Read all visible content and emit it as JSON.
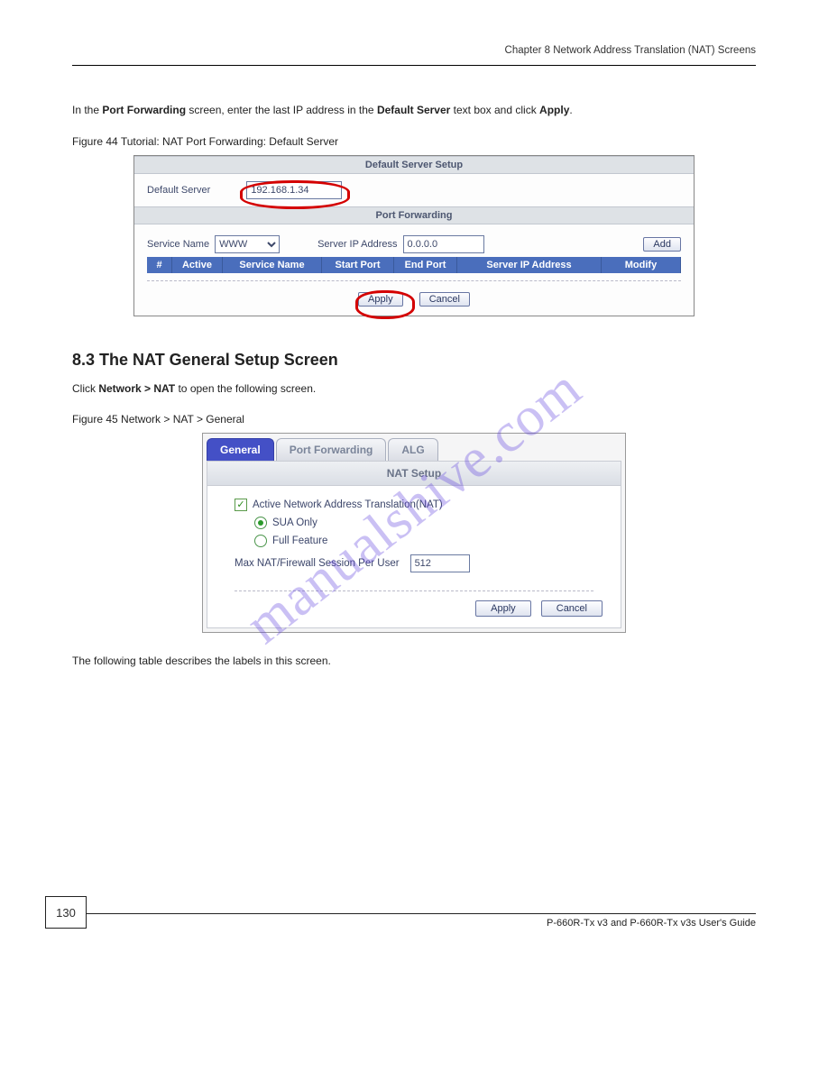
{
  "header": {
    "right_text": "Chapter 8 Network Address Translation (NAT) Screens"
  },
  "intro": {
    "p1_a": "In the ",
    "p1_b": "Port Forwarding",
    "p1_c": " screen, enter the last IP address in the ",
    "p1_d": "Default Server",
    "p1_e": " text box and click ",
    "p1_f": "Apply",
    "p1_g": "."
  },
  "fig1": {
    "caption": "Tutorial: NAT Port Forwarding: Default Server",
    "caption_no": "Figure 44   ",
    "section1_title": "Default Server Setup",
    "default_server_label": "Default Server",
    "default_server_value": "192.168.1.34",
    "section2_title": "Port Forwarding",
    "service_name_label": "Service Name",
    "service_name_value": "WWW",
    "server_ip_label": "Server IP Address",
    "server_ip_value": "0.0.0.0",
    "add_label": "Add",
    "th_num": "#",
    "th_active": "Active",
    "th_name": "Service Name",
    "th_start": "Start Port",
    "th_end": "End Port",
    "th_ip": "Server IP Address",
    "th_modify": "Modify",
    "apply_label": "Apply",
    "cancel_label": "Cancel"
  },
  "section": {
    "number": "8.3  The NAT General Setup Screen",
    "p1_a": "Click ",
    "p1_b": "Network > NAT",
    "p1_c": " to open the following screen."
  },
  "fig2": {
    "caption_no": "Figure 45   ",
    "caption": "Network > NAT > General",
    "tab_general": "General",
    "tab_pf": "Port Forwarding",
    "tab_alg": "ALG",
    "section_title": "NAT Setup",
    "chk_label": "Active Network Address Translation(NAT)",
    "radio_sua": "SUA Only",
    "radio_full": "Full Feature",
    "max_label": "Max NAT/Firewall Session Per User",
    "max_value": "512",
    "apply_label": "Apply",
    "cancel_label": "Cancel"
  },
  "post_text": {
    "p1": "The following table describes the labels in this screen."
  },
  "watermark": "manualshive.com",
  "footer": {
    "page": "130",
    "text": "P-660R-Tx v3 and P-660R-Tx v3s User's Guide"
  }
}
